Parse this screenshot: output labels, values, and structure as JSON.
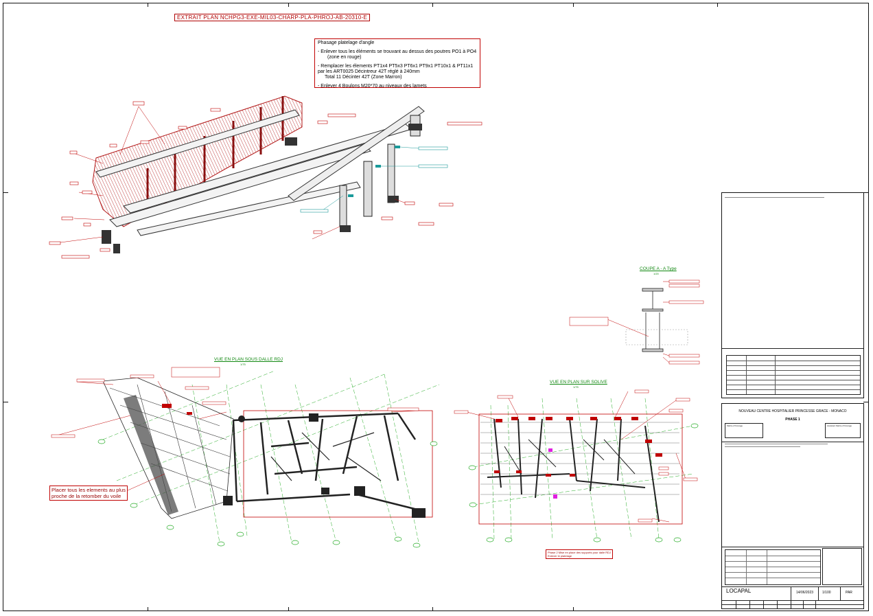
{
  "drawing_ref": "EXTRAIT PLAN NCHPG3-EXE-MIL03-CHARP-PLA-PHROJ-AB-20310-E",
  "phasing_note": {
    "title": "Phasage platelage d'angle",
    "line1": "- Enlever tous les éléments se trouvant au dessus des poutres PO1 à PO4",
    "line2": "(zone en rouge)",
    "line3": "- Remplacer les élements PT1x4 PT5x3 PT6x1 PT9x1 PT10x1 & PT11x1",
    "line4": "par les ART0025 Décintreur 42T réglé à 240mm",
    "line5": "Total 11 Décinter 42T (Zone Marron)",
    "line6": "- Enlever 4 Boulons M20*70 au niveaux des lamets"
  },
  "views": {
    "section_title": "COUPE A - A Type",
    "section_scale": "1/20",
    "plan_under_slab_title": "VUE EN PLAN SOUS DALLE RDJ",
    "plan_under_slab_scale": "1/75",
    "plan_on_joist_title": "VUE EN PLAN SUR SOLIVE",
    "plan_on_joist_scale": "1/75"
  },
  "notes": {
    "place_elements_line1": "Placer tous les elements au plus",
    "place_elements_line2": "proche de la retomber du voile",
    "phase2_line1": "Phase 2 Mise en place des supports pour dalle RDJ",
    "phase2_line2": "Enlever le platelage"
  },
  "title_block": {
    "project": "NOUVEAU CENTRE HOSPITALIER PRINCESSE GRACE - MONACO",
    "phase": "PHASE 1",
    "company": "LOCAPAL",
    "date": "14/06/2023",
    "scale": "1/100",
    "format": "PAR",
    "left_top_label": "Maître d'Ouvrage",
    "right_top_label": "Assistant Maître d'Ouvrage",
    "client_label": "Maîtrise d'Ouvrage"
  },
  "colors": {
    "red": "#c00000",
    "green": "#118811",
    "teal": "#1a9a9a",
    "dark": "#222222",
    "hatch": "#b11515"
  }
}
